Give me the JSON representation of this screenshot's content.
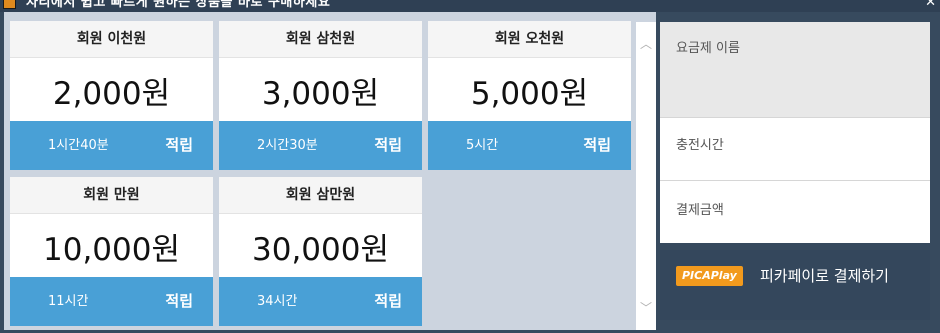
{
  "window": {
    "title": "자리에서 쉽고 빠르게 원하는 상품을 바로 구매하세요",
    "close_icon": "✕"
  },
  "plans": [
    {
      "name": "회원 이천원",
      "price": "2,000원",
      "time": "1시간40분",
      "action": "적립"
    },
    {
      "name": "회원 삼천원",
      "price": "3,000원",
      "time": "2시간30분",
      "action": "적립"
    },
    {
      "name": "회원 오천원",
      "price": "5,000원",
      "time": "5시간",
      "action": "적립"
    },
    {
      "name": "회원 만원",
      "price": "10,000원",
      "time": "11시간",
      "action": "적립"
    },
    {
      "name": "회원 삼만원",
      "price": "30,000원",
      "time": "34시간",
      "action": "적립"
    }
  ],
  "scrollbar": {
    "up_icon": "chevron-up-icon",
    "down_icon": "chevron-down-icon"
  },
  "summary": {
    "plan_name_label": "요금제 이름",
    "charge_time_label": "충전시간",
    "pay_amount_label": "결제금액"
  },
  "pay_button": {
    "logo_text": "PICAPlay",
    "label": "피카페이로 결제하기"
  },
  "colors": {
    "accent_blue": "#49a0d6",
    "dark_panel": "#34475c",
    "logo_orange": "#f29a1d"
  }
}
